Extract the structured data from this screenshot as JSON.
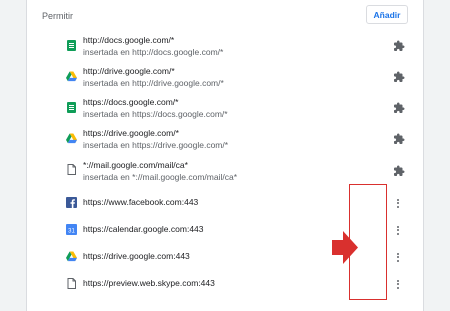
{
  "section": {
    "title": "Permitir",
    "add_label": "Añadir"
  },
  "extension_rows": [
    {
      "origin": "http://docs.google.com/*",
      "added_by": "insertada en http://docs.google.com/*",
      "favicon": "google-docs-icon"
    },
    {
      "origin": "http://drive.google.com/*",
      "added_by": "insertada en http://drive.google.com/*",
      "favicon": "google-drive-icon"
    },
    {
      "origin": "https://docs.google.com/*",
      "added_by": "insertada en https://docs.google.com/*",
      "favicon": "google-docs-icon"
    },
    {
      "origin": "https://drive.google.com/*",
      "added_by": "insertada en https://drive.google.com/*",
      "favicon": "google-drive-icon"
    },
    {
      "origin": "*://mail.google.com/mail/ca*",
      "added_by": "insertada en *://mail.google.com/mail/ca*",
      "favicon": "page-icon"
    }
  ],
  "site_rows": [
    {
      "origin": "https://www.facebook.com:443",
      "favicon": "facebook-icon"
    },
    {
      "origin": "https://calendar.google.com:443",
      "favicon": "google-calendar-icon",
      "favicon_text": "31"
    },
    {
      "origin": "https://drive.google.com:443",
      "favicon": "google-drive-icon"
    },
    {
      "origin": "https://preview.web.skype.com:443",
      "favicon": "page-icon"
    }
  ],
  "colors": {
    "accent": "#1a73e8",
    "annotation_red": "#d9302e",
    "docs_green": "#0f9d58",
    "facebook_blue": "#3b5998",
    "calendar_blue": "#4285f4"
  }
}
